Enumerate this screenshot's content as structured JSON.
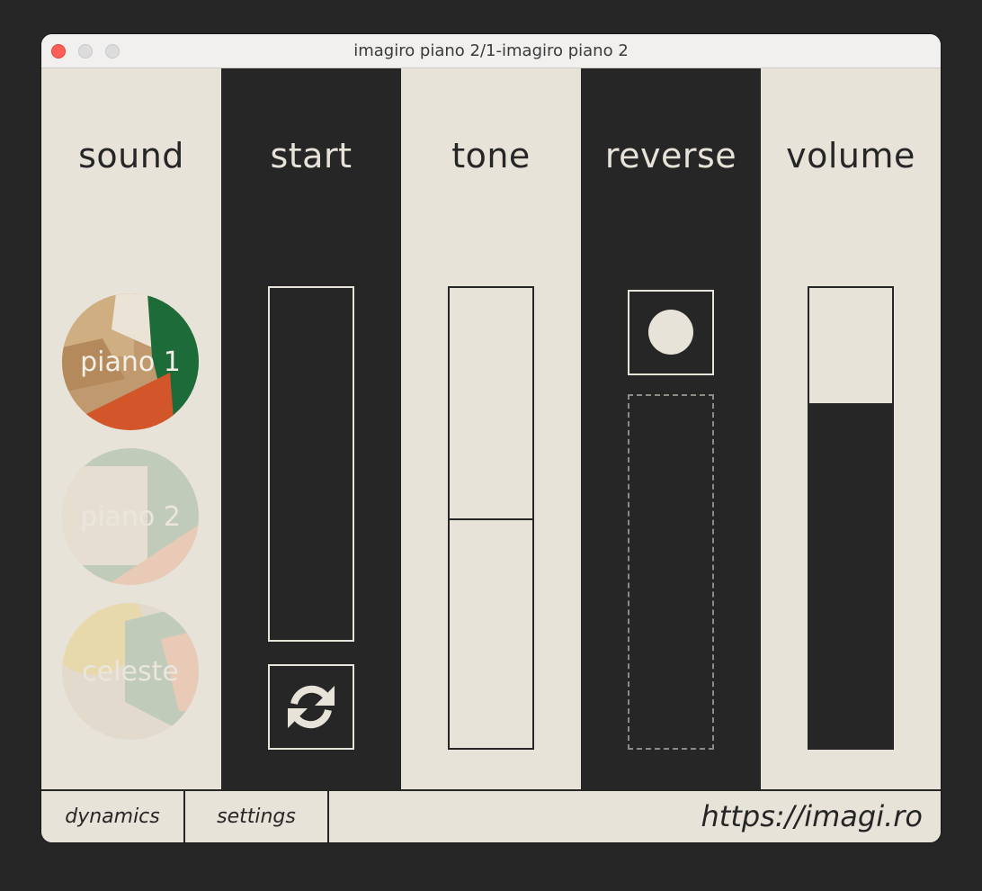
{
  "window": {
    "title": "imagiro piano 2/1-imagiro piano 2"
  },
  "columns": {
    "sound": "sound",
    "start": "start",
    "tone": "tone",
    "reverse": "reverse",
    "volume": "volume"
  },
  "sounds": [
    {
      "label": "piano 1",
      "selected": true
    },
    {
      "label": "piano 2",
      "selected": false
    },
    {
      "label": "celeste",
      "selected": false
    }
  ],
  "controls": {
    "start_level": 0,
    "tone_level": 0.5,
    "reverse_active": false,
    "volume_level": 0.75,
    "reset_icon": "refresh-icon",
    "reverse_icon": "record-dot-icon"
  },
  "footer": {
    "dynamics": "dynamics",
    "settings": "settings",
    "url": "https://imagi.ro"
  },
  "colors": {
    "cream": "#e8e3d9",
    "dark": "#262626",
    "accent_green": "#1e6b3a",
    "accent_orange": "#d2562a"
  }
}
